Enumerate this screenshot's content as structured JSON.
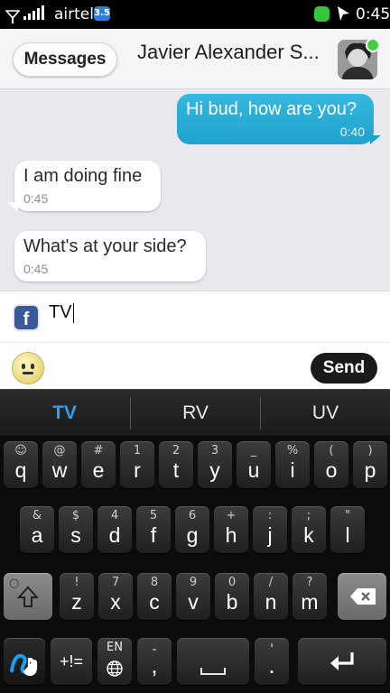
{
  "status_bar": {
    "carrier": "airtel",
    "network_badge": "3.5",
    "time": "0:45"
  },
  "header": {
    "back_label": "Messages",
    "contact_name": "Javier Alexander S..."
  },
  "messages": [
    {
      "direction": "outgoing",
      "text": "Hi bud, how are you?",
      "time": "0:40"
    },
    {
      "direction": "incoming",
      "text": "I am doing fine",
      "time": "0:45"
    },
    {
      "direction": "incoming",
      "text": "What's at your side?",
      "time": "0:45"
    }
  ],
  "composer": {
    "value": "TV",
    "send_label": "Send",
    "fb_glyph": "f"
  },
  "suggestions": [
    {
      "label": "TV",
      "selected": true
    },
    {
      "label": "RV",
      "selected": false
    },
    {
      "label": "UV",
      "selected": false
    }
  ],
  "keyboard": {
    "row1": [
      {
        "key": "q",
        "alt": "☺"
      },
      {
        "key": "w",
        "alt": "@"
      },
      {
        "key": "e",
        "alt": "#"
      },
      {
        "key": "r",
        "alt": "1"
      },
      {
        "key": "t",
        "alt": "2"
      },
      {
        "key": "y",
        "alt": "3"
      },
      {
        "key": "u",
        "alt": "_"
      },
      {
        "key": "i",
        "alt": "%"
      },
      {
        "key": "o",
        "alt": "("
      },
      {
        "key": "p",
        "alt": ")"
      }
    ],
    "row2": [
      {
        "key": "a",
        "alt": "&"
      },
      {
        "key": "s",
        "alt": "$"
      },
      {
        "key": "d",
        "alt": "4"
      },
      {
        "key": "f",
        "alt": "5"
      },
      {
        "key": "g",
        "alt": "6"
      },
      {
        "key": "h",
        "alt": "+"
      },
      {
        "key": "j",
        "alt": ":"
      },
      {
        "key": "k",
        "alt": ";"
      },
      {
        "key": "l",
        "alt": "\""
      }
    ],
    "row3": [
      {
        "key": "z",
        "alt": "!"
      },
      {
        "key": "x",
        "alt": "7"
      },
      {
        "key": "c",
        "alt": "8"
      },
      {
        "key": "v",
        "alt": "9"
      },
      {
        "key": "b",
        "alt": "0"
      },
      {
        "key": "n",
        "alt": "/"
      },
      {
        "key": "m",
        "alt": "?"
      }
    ],
    "symbols_label": "+!=",
    "language_label": "EN",
    "comma_alt": "-",
    "comma_label": ",",
    "period_alt": "'",
    "period_label": "."
  },
  "colors": {
    "outgoing_bubble": "#1ea3cf",
    "suggestion_selected": "#2e9ff0",
    "facebook": "#3b5998"
  }
}
